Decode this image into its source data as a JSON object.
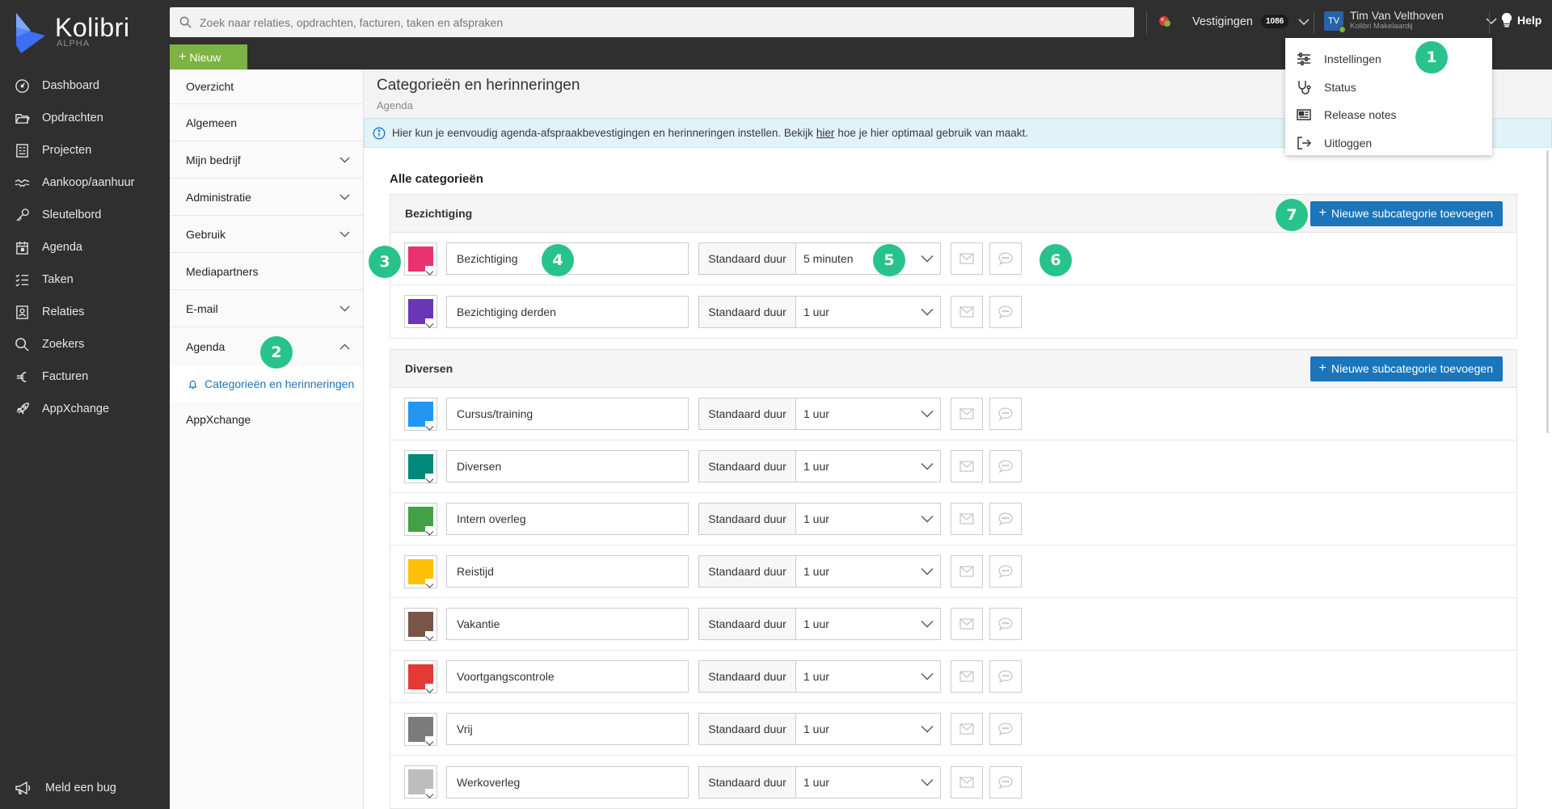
{
  "app": {
    "name": "Kolibri",
    "edition": "ALPHA"
  },
  "nav": {
    "items": [
      {
        "label": "Dashboard",
        "icon": "dashboard-icon"
      },
      {
        "label": "Opdrachten",
        "icon": "folder-open-icon"
      },
      {
        "label": "Projecten",
        "icon": "building-icon"
      },
      {
        "label": "Aankoop/aanhuur",
        "icon": "handshake-icon"
      },
      {
        "label": "Sleutelbord",
        "icon": "key-icon"
      },
      {
        "label": "Agenda",
        "icon": "calendar-icon"
      },
      {
        "label": "Taken",
        "icon": "checklist-icon"
      },
      {
        "label": "Relaties",
        "icon": "contacts-icon"
      },
      {
        "label": "Zoekers",
        "icon": "search-icon"
      },
      {
        "label": "Facturen",
        "icon": "euro-icon"
      },
      {
        "label": "AppXchange",
        "icon": "rocket-icon"
      }
    ],
    "bug_label": "Meld een bug"
  },
  "topbar": {
    "search_placeholder": "Zoek naar relaties, opdrachten, facturen, taken en afspraken",
    "new_label": "Nieuw",
    "vestigingen_label": "Vestigingen",
    "vestigingen_count": "1086",
    "user_initials": "TV",
    "user_name": "Tim Van Velthoven",
    "user_company": "Kolibri Makelaardij",
    "help_label": "Help"
  },
  "user_menu": [
    {
      "label": "Instellingen",
      "icon": "sliders-icon"
    },
    {
      "label": "Status",
      "icon": "stethoscope-icon"
    },
    {
      "label": "Release notes",
      "icon": "newspaper-icon"
    },
    {
      "label": "Uitloggen",
      "icon": "logout-icon"
    }
  ],
  "settings_menu": {
    "overzicht": "Overzicht",
    "algemeen": "Algemeen",
    "mijn_bedrijf": "Mijn bedrijf",
    "administratie": "Administratie",
    "gebruik": "Gebruik",
    "mediapartners": "Mediapartners",
    "email": "E-mail",
    "agenda": "Agenda",
    "agenda_sub": "Categorieën en herinneringen",
    "appxchange": "AppXchange"
  },
  "page": {
    "title": "Categorieën en herinneringen",
    "subtitle": "Agenda",
    "info_before": "Hier kun je eenvoudig agenda-afspraakbevestigingen en herinneringen instellen. Bekijk",
    "info_link": "hier",
    "info_after": "hoe je hier optimaal gebruik van maakt.",
    "section_title": "Alle categorieën",
    "duration_label": "Standaard duur",
    "add_subcategory_label": "Nieuwe subcategorie toevoegen"
  },
  "groups": [
    {
      "name": "Bezichtiging",
      "rows": [
        {
          "name": "Bezichtiging",
          "color": "#e8336f",
          "duration": "5 minuten"
        },
        {
          "name": "Bezichtiging derden",
          "color": "#6a35b6",
          "duration": "1 uur"
        }
      ]
    },
    {
      "name": "Diversen",
      "rows": [
        {
          "name": "Cursus/training",
          "color": "#2196f3",
          "duration": "1 uur"
        },
        {
          "name": "Diversen",
          "color": "#00897b",
          "duration": "1 uur"
        },
        {
          "name": "Intern overleg",
          "color": "#43a047",
          "duration": "1 uur"
        },
        {
          "name": "Reistijd",
          "color": "#ffc107",
          "duration": "1 uur"
        },
        {
          "name": "Vakantie",
          "color": "#795548",
          "duration": "1 uur"
        },
        {
          "name": "Voortgangscontrole",
          "color": "#e53935",
          "duration": "1 uur"
        },
        {
          "name": "Vrij",
          "color": "#7b7b7b",
          "duration": "1 uur"
        },
        {
          "name": "Werkoverleg",
          "color": "#bdbdbd",
          "duration": "1 uur"
        }
      ]
    }
  ],
  "markers": [
    "1",
    "2",
    "3",
    "4",
    "5",
    "6",
    "7"
  ],
  "colors": {
    "sidebar": "#2f2f2f",
    "accent": "#1b75bb",
    "new_button": "#7cb342",
    "marker": "#27c38a"
  }
}
